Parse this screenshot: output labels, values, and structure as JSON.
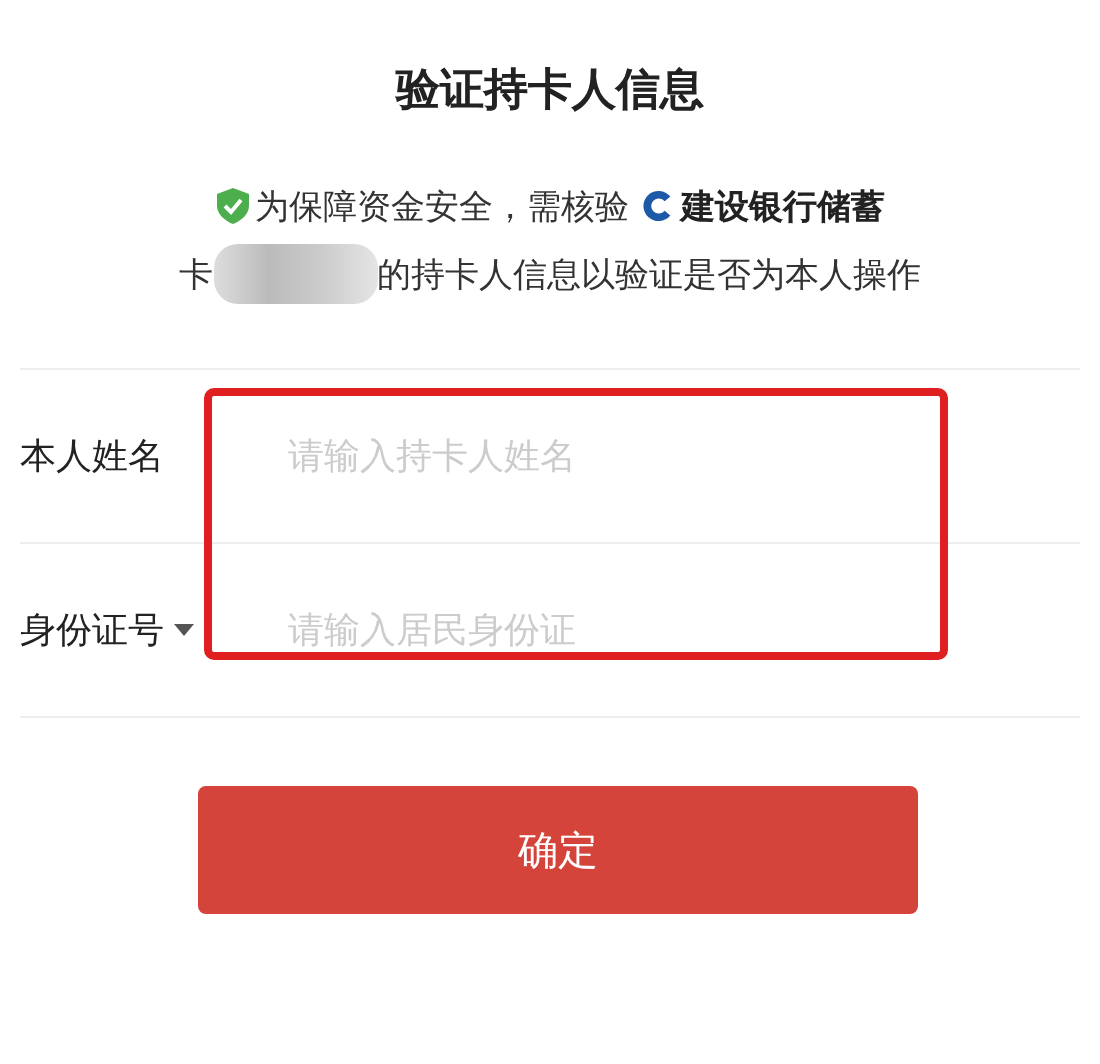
{
  "title": "验证持卡人信息",
  "notice": {
    "line_1": "为保障资金安全，需核验",
    "bank_name": "建设银行储蓄",
    "line_2_start": "卡",
    "redacted": true,
    "line_2_end": "的持卡人信息以验证是否为本人操作"
  },
  "fields": [
    {
      "label": "本人姓名",
      "placeholder": "请输入持卡人姓名",
      "dropdown": false
    },
    {
      "label": "身份证号",
      "placeholder": "请输入居民身份证",
      "dropdown": true
    }
  ],
  "confirm_button": "确定",
  "annotation": {
    "kind": "highlight"
  }
}
